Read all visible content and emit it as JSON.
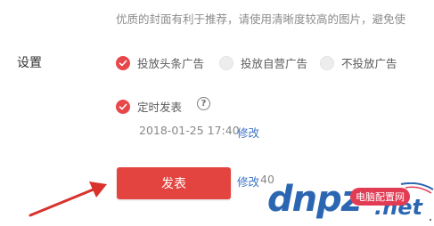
{
  "cover_hint": "优质的封面有利于推荐，请使用清晰度较高的图片，避免使",
  "settings_label": "设置",
  "ad_options": [
    {
      "label": "投放头条广告",
      "checked": true
    },
    {
      "label": "投放自营广告",
      "checked": false
    },
    {
      "label": "不投放广告",
      "checked": false
    }
  ],
  "scheduled": {
    "label": "定时发表",
    "checked": true,
    "help": "?"
  },
  "datetime": "2018-01-25 17:40",
  "edit_link": "修改",
  "publish_button": "发表",
  "edit_link_2": "修改",
  "count": "40",
  "colors": {
    "accent": "#e4443f",
    "link": "#3b73c9"
  },
  "watermark": {
    "main": "dnpz",
    "domain": ".net",
    "badge": "电脑配置网"
  },
  "icons": [
    "check-icon",
    "help-icon",
    "red-arrow"
  ]
}
